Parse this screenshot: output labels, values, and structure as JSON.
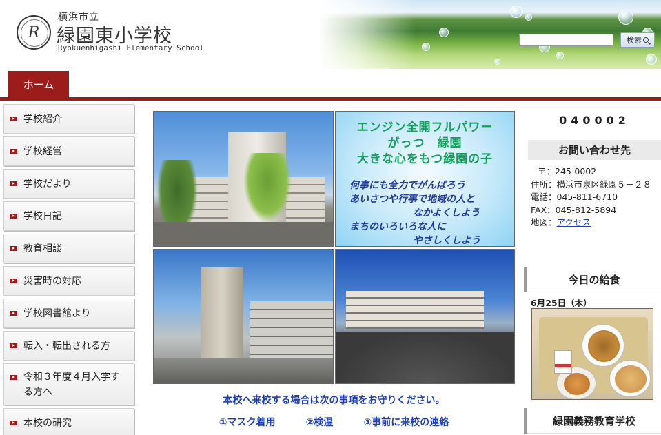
{
  "header": {
    "school_city": "横浜市立",
    "school_name": "緑園東小学校",
    "school_name_en": "Ryokuenhigashi Elementary School",
    "logo_letter": "R",
    "search": {
      "placeholder": "",
      "button_label": "検索"
    }
  },
  "nav": {
    "home_label": "ホーム"
  },
  "sidebar": {
    "items": [
      {
        "label": "学校紹介"
      },
      {
        "label": "学校経営"
      },
      {
        "label": "学校だより"
      },
      {
        "label": "学校日記"
      },
      {
        "label": "教育相談"
      },
      {
        "label": "災害時の対応"
      },
      {
        "label": "学校図書館より"
      },
      {
        "label": "転入・転出される方"
      },
      {
        "label": "令和３年度４月入学する方へ"
      },
      {
        "label": "本校の研究"
      }
    ]
  },
  "slogan": {
    "line1": "エンジン全開フルパワー",
    "line2": "がっつ　緑園",
    "line3": "大きな心をもつ緑園の子",
    "line4": "何事にも全力でがんばろう",
    "line5": "あいさつや行事で地域の人と",
    "line6": "なかよくしよう",
    "line7": "まちのいろいろな人に",
    "line8": "やさしくしよう"
  },
  "notice": {
    "text": "本校へ来校する場合は次の事項をお守りください。",
    "rules": [
      "①マスク着用",
      "②検温",
      "③事前に来校の連絡"
    ]
  },
  "right": {
    "counter": "040002",
    "contact_title": "お問い合わせ先",
    "postal": "〒：245-0002",
    "address": "住所：横浜市泉区緑園５－２８",
    "phone": "電話：045-811-6710",
    "fax": "FAX：045-812-5894",
    "map_label": "地図：",
    "map_link": "アクセス",
    "lunch_title": "今日の給食",
    "lunch_date": "6月25日（木）",
    "school_link": "緑園義務教育学校"
  },
  "colors": {
    "accent": "#9c1c1c",
    "link": "#1d3fb2",
    "slogan_green": "#12a05a"
  }
}
